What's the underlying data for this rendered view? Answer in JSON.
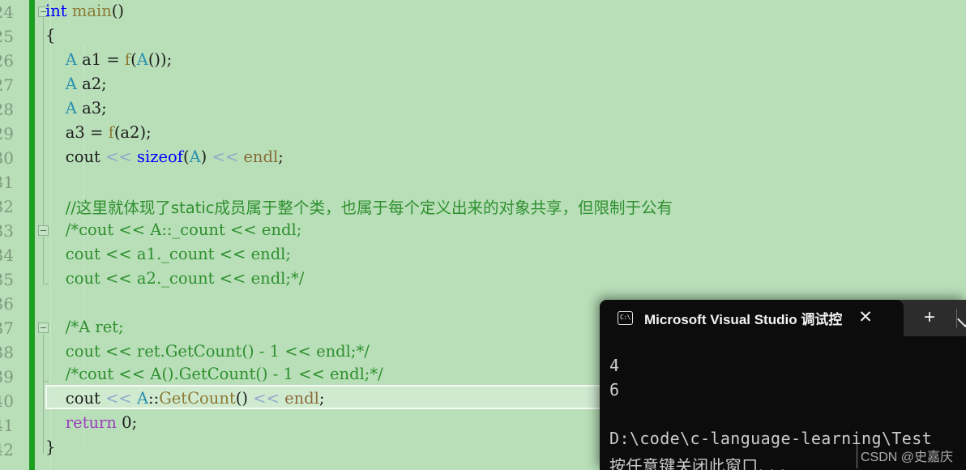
{
  "editor": {
    "background_color": "#b8dfb8",
    "change_bar_color": "#1f9f1f",
    "current_line_number": 40,
    "first_line_number": 24,
    "lines": [
      {
        "n": "24",
        "indent": 0
      },
      {
        "n": "25",
        "indent": 0
      },
      {
        "n": "26",
        "indent": 0
      },
      {
        "n": "27",
        "indent": 0
      },
      {
        "n": "28",
        "indent": 0
      },
      {
        "n": "29",
        "indent": 0
      },
      {
        "n": "30",
        "indent": 0
      },
      {
        "n": "31",
        "indent": 0
      },
      {
        "n": "32",
        "indent": 0
      },
      {
        "n": "33",
        "indent": 0
      },
      {
        "n": "34",
        "indent": 0
      },
      {
        "n": "35",
        "indent": 0
      },
      {
        "n": "36",
        "indent": 0
      },
      {
        "n": "37",
        "indent": 0
      },
      {
        "n": "38",
        "indent": 0
      },
      {
        "n": "39",
        "indent": 0
      },
      {
        "n": "40",
        "indent": 0
      },
      {
        "n": "41",
        "indent": 0
      },
      {
        "n": "42",
        "indent": 0
      }
    ],
    "code_lines": [
      "int main()",
      "{",
      "    A a1 = f(A());",
      "    A a2;",
      "    A a3;",
      "    a3 = f(a2);",
      "    cout << sizeof(A) << endl;",
      "",
      "    //这里就体现了static成员属于整个类，也属于每个定义出来的对象共享，但限制于公有",
      "    /*cout << A::_count << endl;",
      "    cout << a1._count << endl;",
      "    cout << a2._count << endl;*/",
      "",
      "    /*A ret;",
      "    cout << ret.GetCount() - 1 << endl;*/",
      "    /*cout << A().GetCount() - 1 << endl;*/",
      "    cout << A::GetCount() << endl;",
      "    return 0;",
      "}"
    ],
    "syntax_colors": {
      "keyword": "#0000ff",
      "keyword_return": "#9b3fbd",
      "type": "#2b91af",
      "function": "#8a7a34",
      "operator": "#8fa9cd",
      "comment": "#2f8f2f",
      "stream_manip": "#8a6b3a",
      "identifier": "#1c1c1c"
    }
  },
  "terminal": {
    "tab": {
      "icon": "console-icon",
      "icon_text": "C:\\",
      "title": "Microsoft Visual Studio 调试控",
      "close_label": "✕"
    },
    "new_tab_label": "+",
    "dropdown_label": "⌄",
    "output": [
      "4",
      "6",
      "",
      "D:\\code\\c-language-learning\\Test",
      "按任意键关闭此窗口. . ."
    ],
    "background_color": "#0c0c0c",
    "titlebar_color": "#2c2c2c",
    "text_color": "#cccccc"
  },
  "watermark": {
    "text": "CSDN @史嘉庆"
  }
}
